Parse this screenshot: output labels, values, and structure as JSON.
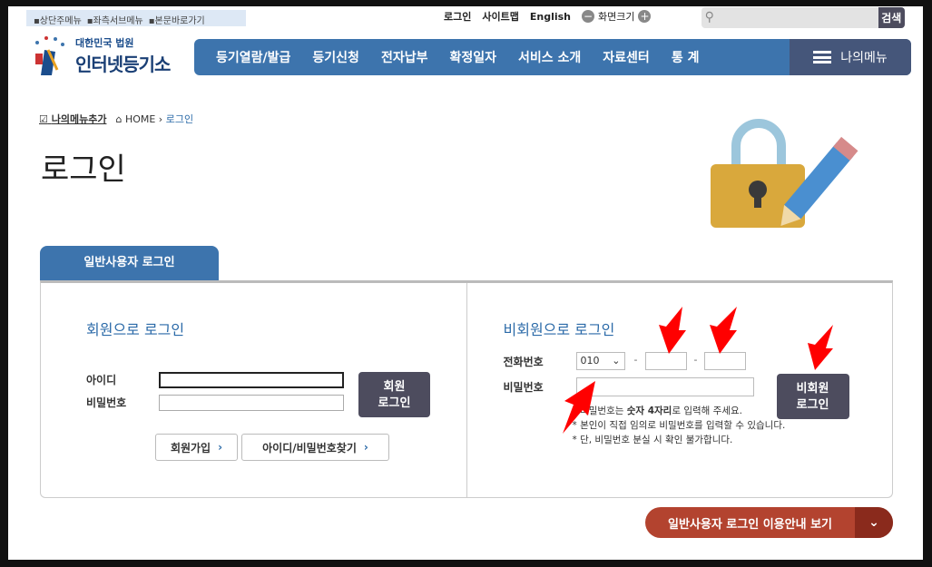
{
  "skip_links": [
    "▪상단주메뉴",
    "▪좌측서브메뉴",
    "▪본문바로가기"
  ],
  "util": {
    "login": "로그인",
    "sitemap": "사이트맵",
    "english": "English",
    "zoom_label": "화면크기",
    "search_button": "검색",
    "search_placeholder": ""
  },
  "logo": {
    "line1": "대한민국 법원",
    "line2": "인터넷등기소"
  },
  "gnb": [
    "등기열람/발급",
    "등기신청",
    "전자납부",
    "확정일자",
    "서비스 소개",
    "자료센터",
    "통 계"
  ],
  "my_menu": "나의메뉴",
  "breadcrumb": {
    "add": "나의메뉴추가",
    "home": "HOME",
    "current": "로그인"
  },
  "page_title": "로그인",
  "tab": "일반사용자 로그인",
  "member": {
    "title": "회원으로 로그인",
    "id_label": "아이디",
    "pw_label": "비밀번호",
    "login": "회원\n로그인",
    "join": "회원가입",
    "find": "아이디/비밀번호찾기"
  },
  "nonmember": {
    "title": "비회원으로 로그인",
    "phone_label": "전화번호",
    "phone_prefix": "010",
    "dash": "-",
    "pw_label": "비밀번호",
    "login": "비회원\n로그인",
    "note1_pre": "* 비밀번호는 ",
    "note1_bold": "숫자 4자리",
    "note1_post": "로 입력해 주세요.",
    "note2": "* 본인이 직접 임의로 비밀번호를 입력할 수 있습니다.",
    "note3": "* 단, 비밀번호 분실 시 확인 불가합니다."
  },
  "guide_button": "일반사용자 로그인 이용안내 보기",
  "colors": {
    "nav": "#3d74ad",
    "dark_button": "#4d4c5e",
    "guide": "#b3432f",
    "annotation_arrow": "#ff0000"
  }
}
